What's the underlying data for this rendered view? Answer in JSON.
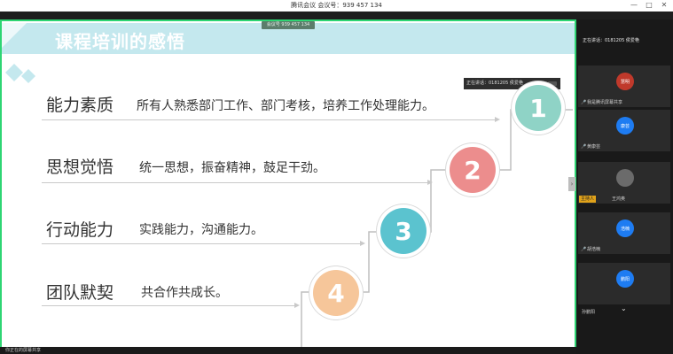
{
  "window": {
    "title": "腾讯会议 会议号：939 457 134",
    "controls": [
      "—",
      "□",
      "✕"
    ]
  },
  "share": {
    "tag": "会议号 939 457 134"
  },
  "slide": {
    "title": "课程培训的感悟",
    "rows": [
      {
        "head": "能力素质",
        "desc": "所有人熟悉部门工作、部门考核，培养工作处理能力。",
        "num": "1",
        "color": "#8fd3c6"
      },
      {
        "head": "思想觉悟",
        "desc": "统一思想，振奋精神，鼓足干劲。",
        "num": "2",
        "color": "#ec8d8d"
      },
      {
        "head": "行动能力",
        "desc": "实践能力，沟通能力。",
        "num": "3",
        "color": "#5bc3cf"
      },
      {
        "head": "团队默契",
        "desc": "共合作共成长。",
        "num": "4",
        "color": "#f6c69a"
      }
    ],
    "band_color": "#c4e8ee"
  },
  "speaker_float": {
    "text": "正在讲话：0181205 侯爱艳"
  },
  "panel": {
    "speaking": "正在讲话：0181205 侯爱艳",
    "participants": [
      {
        "avatar": "慧明",
        "avatar_color": "#c0392b",
        "name": "我是腾讯屏幕共享"
      },
      {
        "avatar": "康芸",
        "avatar_color": "#1e7cf2",
        "name": "黄康芸"
      },
      {
        "avatar": "",
        "avatar_color": "#6b6b6b",
        "name": "王鸿奥",
        "host": "主持人"
      },
      {
        "avatar": "浩楠",
        "avatar_color": "#1e7cf2",
        "name": "胡浩楠"
      },
      {
        "avatar": "鹏阳",
        "avatar_color": "#1e7cf2",
        "name": ""
      }
    ],
    "footer": "孙鹏阳",
    "chevron": "⌄"
  },
  "collapse_icon": "›",
  "bottom": {
    "text": "你正在的屏幕共享"
  }
}
